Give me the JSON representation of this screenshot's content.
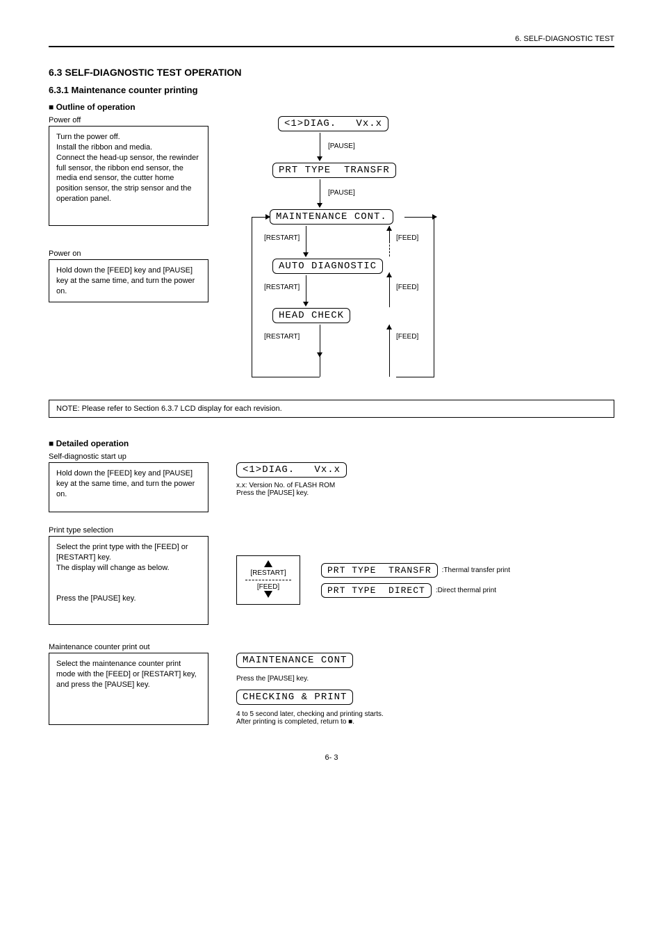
{
  "header_right": "6. SELF-DIAGNOSTIC TEST",
  "hr_rule": "──",
  "section1": {
    "title": "6.3 SELF-DIAGNOSTIC TEST OPERATION",
    "title2": "6.3.1 Maintenance counter printing",
    "outline": "■ Outline of operation",
    "step1": {
      "label": "Power off",
      "box": "Turn the power off.\nInstall the ribbon and media.\nConnect the head-up sensor, the rewinder full sensor, the ribbon end sensor, the media end sensor, the cutter home position sensor, the strip sensor and the operation panel."
    },
    "step2": {
      "label": "Power on",
      "box": "Hold down the [FEED] key and [PAUSE] key at the same time, and turn the power on."
    },
    "diagram": {
      "n1": "<1>DIAG.   Vx.x",
      "n1_lab": "[PAUSE]",
      "n2": "PRT TYPE  TRANSFR",
      "n2_lab": "[PAUSE]",
      "n3": "MAINTENANCE CONT.",
      "n3_lab_l": "[RESTART]",
      "n3_lab_r": "[FEED]",
      "n4": "AUTO DIAGNOSTIC",
      "n4_lab_l": "[RESTART]",
      "n4_lab_r": "[FEED]",
      "n5": "HEAD CHECK",
      "n5_lab_l": "[RESTART]",
      "n5_lab_r": "[FEED]"
    },
    "note": "NOTE: Please refer to Section 6.3.7 LCD display for each revision."
  },
  "section2": {
    "title": "■ Detailed operation",
    "step1": {
      "label": "Self-diagnostic start up",
      "box": "Hold down the [FEED] key and [PAUSE] key at the same time, and turn the power on.",
      "lcd": "<1>DIAG.   Vx.x",
      "after": "x.x: Version No. of FLASH ROM\nPress the [PAUSE] key."
    },
    "step2": {
      "label": "Print type selection",
      "box": "Select the print type with the [FEED] or [RESTART] key.\nThe display will change as below.\n\n\nPress the [PAUSE] key.",
      "key_up": "[RESTART]",
      "key_dn": "[FEED]",
      "lcd_a": "PRT TYPE  TRANSFR",
      "lab_a": ":Thermal transfer print",
      "lcd_b": "PRT TYPE  DIRECT",
      "lab_b": ":Direct thermal print"
    },
    "step3": {
      "label": "Maintenance counter print out",
      "box": "Select the maintenance counter print mode with the [FEED] or [RESTART] key, and press the [PAUSE] key.",
      "lcd1": "MAINTENANCE CONT",
      "mid": "Press the [PAUSE] key.",
      "lcd2": "CHECKING & PRINT",
      "after": "4 to 5 second later, checking and printing starts.\nAfter printing is completed, return to ■."
    }
  },
  "footer": "6- 3"
}
